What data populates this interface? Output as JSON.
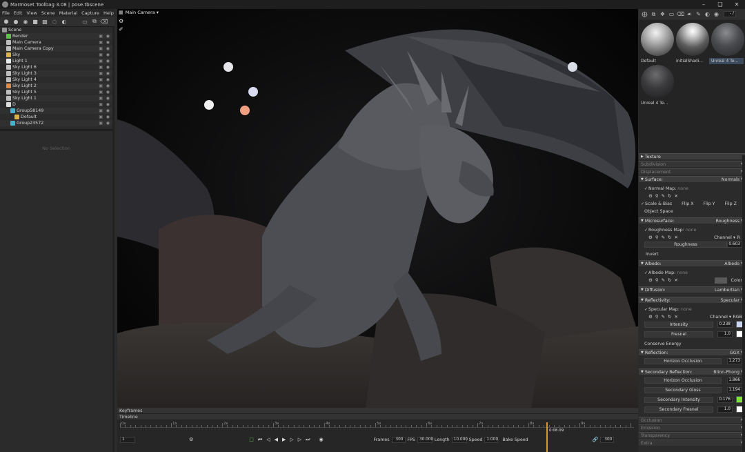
{
  "window": {
    "title": "Marmoset Toolbag 3.08  |  pose.tbscene",
    "controls": [
      "–",
      "❑",
      "✕"
    ]
  },
  "menu": [
    "File",
    "Edit",
    "View",
    "Scene",
    "Material",
    "Capture",
    "Help"
  ],
  "scene_tree": [
    {
      "label": "Scene",
      "icon": "scene-icon",
      "indent": 0,
      "color": "#9a9a9a"
    },
    {
      "label": "Render",
      "icon": "render-icon",
      "indent": 1,
      "color": "#5ec24a"
    },
    {
      "label": "Main Camera",
      "icon": "camera-icon",
      "indent": 1,
      "color": "#bdbdbd"
    },
    {
      "label": "Main Camera Copy",
      "icon": "camera-icon",
      "indent": 1,
      "color": "#bdbdbd"
    },
    {
      "label": "Sky",
      "icon": "sky-icon",
      "indent": 1,
      "color": "#d9b24a"
    },
    {
      "label": "Light 1",
      "icon": "light-icon",
      "indent": 1,
      "color": "#eaeaea"
    },
    {
      "label": "Sky Light 6",
      "icon": "light-icon",
      "indent": 1,
      "color": "#bdbdbd"
    },
    {
      "label": "Sky Light 3",
      "icon": "light-icon",
      "indent": 1,
      "color": "#bdbdbd"
    },
    {
      "label": "Sky Light 4",
      "icon": "light-icon",
      "indent": 1,
      "color": "#bdbdbd"
    },
    {
      "label": "Sky Light 2",
      "icon": "light-icon",
      "indent": 1,
      "color": "#e08a4a"
    },
    {
      "label": "Sky Light 5",
      "icon": "light-icon",
      "indent": 1,
      "color": "#bdbdbd"
    },
    {
      "label": "Sky Light 1",
      "icon": "light-icon",
      "indent": 1,
      "color": "#bdbdbd"
    },
    {
      "label": "D",
      "icon": "object-icon",
      "indent": 1,
      "color": "#dcdcdc"
    },
    {
      "label": "Group58149",
      "icon": "group-icon",
      "indent": 2,
      "color": "#4ab0c9"
    },
    {
      "label": "Default",
      "icon": "material-icon",
      "indent": 3,
      "color": "#d9b24a"
    },
    {
      "label": "Group23572",
      "icon": "group-icon",
      "indent": 2,
      "color": "#4ab0c9"
    }
  ],
  "left_panel": {
    "no_selection": "No Selection"
  },
  "viewport": {
    "camera_label": "Main Camera ▾"
  },
  "timeline": {
    "keyframes_label": "Keyframes",
    "timeline_label": "Timeline",
    "ruler_labels": [
      "0s",
      "1s",
      "2s",
      "3s",
      "4s",
      "5s",
      "6s",
      "7s",
      "8s",
      "9s"
    ],
    "current_time": "0:08.09",
    "start_frame": "1",
    "frames_label": "Frames",
    "frames_value": "300",
    "fps_label": "FPS",
    "fps_value": "30.000",
    "length_label": "Length",
    "length_value": "10.000",
    "speed_label": "Speed",
    "speed_value": "1.000",
    "bake_speed_label": "Bake Speed",
    "end_frame": "300"
  },
  "materials": [
    {
      "label": "Default",
      "selected": false,
      "style": "light"
    },
    {
      "label": "initialShadi...",
      "selected": false,
      "style": "chrome"
    },
    {
      "label": "Unreal 4 Te...",
      "selected": true,
      "style": "dark"
    },
    {
      "label": "Unreal 4 Te...",
      "selected": false,
      "style": "darker"
    }
  ],
  "material_props": {
    "texture": "Texture",
    "subdivision": "Subdivision",
    "displacement": "Displacement",
    "surface": "Surface:",
    "surface_val": "Normals",
    "normal_map": "Normal Map:",
    "none": "none",
    "scale_bias": "Scale & Bias",
    "flip_x": "Flip X",
    "flip_y": "Flip Y",
    "flip_z": "Flip Z",
    "object_space": "Object Space",
    "microsurface": "Microsurface:",
    "microsurface_val": "Roughness",
    "roughness_map": "Roughness Map:",
    "channel_label": "Channel ▾",
    "channel_r": "R",
    "roughness": "Roughness",
    "roughness_val": "0.603",
    "invert": "Invert",
    "albedo": "Albedo:",
    "albedo_val": "Albedo",
    "albedo_map": "Albedo Map:",
    "color": "Color",
    "diffusion": "Diffusion:",
    "diffusion_val": "Lambertian",
    "reflectivity": "Reflectivity:",
    "reflectivity_val": "Specular",
    "specular_map": "Specular Map:",
    "channel_rgb": "RGB",
    "intensity": "Intensity",
    "intensity_val": "0.238",
    "fresnel": "Fresnel",
    "fresnel_val": "1.0",
    "conserve_energy": "Conserve Energy",
    "reflection": "Reflection:",
    "reflection_val": "GGX",
    "horizon_occlusion": "Horizon Occlusion",
    "horizon_occlusion_val": "1.273",
    "secondary_reflection": "Secondary Reflection:",
    "secondary_reflection_val": "Blinn-Phong",
    "horizon_occlusion2_val": "1.866",
    "secondary_gloss": "Secondary Gloss",
    "secondary_gloss_val": "1.194",
    "secondary_intensity": "Secondary Intensity",
    "secondary_intensity_val": "0.176",
    "secondary_fresnel": "Secondary Fresnel",
    "secondary_fresnel_val": "1.0",
    "occlusion": "Occlusion",
    "emission": "Emission",
    "transparency": "Transparency",
    "extra": "Extra"
  },
  "colors": {
    "intensity_swatch": "#c8d4f0",
    "fresnel_swatch": "#ffffff",
    "sec_intensity_swatch": "#7ee23a",
    "sec_fresnel_swatch": "#ffffff",
    "albedo_swatch": "#5a5a5a",
    "playhead": "#d49a2a"
  }
}
